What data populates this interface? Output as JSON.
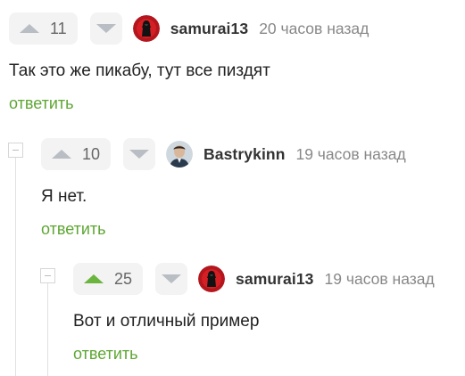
{
  "colors": {
    "accent_green": "#5ea633",
    "vote_active": "#6bb53e",
    "vote_inactive": "#b8bec4",
    "vote_bg": "#f3f3f3",
    "muted": "#888888"
  },
  "comments": [
    {
      "score": "11",
      "upvoted": false,
      "username": "samurai13",
      "time": "20 часов назад",
      "text": "Так это же пикабу, тут все пиздят",
      "reply_label": "ответить",
      "avatar_icon": "samurai-avatar-icon"
    },
    {
      "score": "10",
      "upvoted": false,
      "username": "Bastrykinn",
      "time": "19 часов назад",
      "text": "Я нет.",
      "reply_label": "ответить",
      "avatar_icon": "person-avatar-icon"
    },
    {
      "score": "25",
      "upvoted": true,
      "username": "samurai13",
      "time": "19 часов назад",
      "text": "Вот и отличный пример",
      "reply_label": "ответить",
      "avatar_icon": "samurai-avatar-icon"
    }
  ]
}
